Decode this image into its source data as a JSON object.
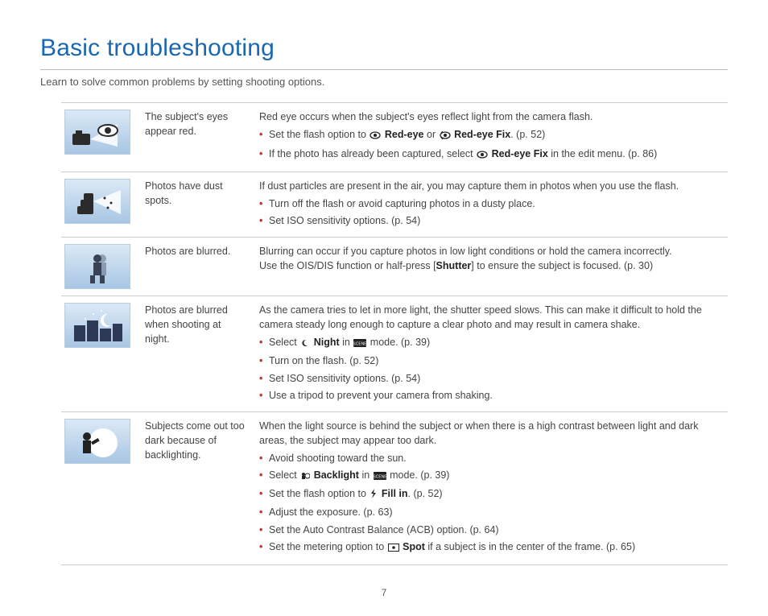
{
  "title": "Basic troubleshooting",
  "intro": "Learn to solve common problems by setting shooting options.",
  "page_number": "7",
  "rows": [
    {
      "problem": "The subject's eyes appear red.",
      "lead": "Red eye occurs when the subject's eyes reflect light from the camera flash.",
      "bullets_a": {
        "b0_pre": "Set the flash option to ",
        "b0_bold1": "Red-eye",
        "b0_mid": " or ",
        "b0_bold2": "Red-eye Fix",
        "b0_post": ". (p. 52)",
        "b1_pre": "If the photo has already been captured, select ",
        "b1_bold": "Red-eye Fix",
        "b1_post": " in the edit menu. (p. 86)"
      }
    },
    {
      "problem": "Photos have dust spots.",
      "lead": "If dust particles are present in the air, you may capture them in photos when you use the flash.",
      "bullets_b": {
        "b0": "Turn off the flash or avoid capturing photos in a dusty place.",
        "b1": "Set ISO sensitivity options. (p. 54)"
      }
    },
    {
      "problem": "Photos are blurred.",
      "lead_pre": "Blurring can occur if you capture photos in low light conditions or hold the camera incorrectly.\nUse the OIS/DIS function or half-press [",
      "lead_bold": "Shutter",
      "lead_post": "] to ensure the subject is focused. (p. 30)"
    },
    {
      "problem": "Photos are blurred when shooting at night.",
      "lead": "As the camera tries to let in more light, the shutter speed slows. This can make it difficult to hold the camera steady long enough to capture a clear photo and may result in camera shake.",
      "bullets_c": {
        "b0_pre": "Select ",
        "b0_bold": "Night",
        "b0_mid": " in ",
        "b0_post": " mode. (p. 39)",
        "b1": "Turn on the flash. (p. 52)",
        "b2": "Set ISO sensitivity options. (p. 54)",
        "b3": "Use a tripod to prevent your camera from shaking."
      }
    },
    {
      "problem": "Subjects come out too dark because of backlighting.",
      "lead": "When the light source is behind the subject or when there is a high contrast between light and dark areas, the subject may appear too dark.",
      "bullets_d": {
        "b0": "Avoid shooting toward the sun.",
        "b1_pre": "Select ",
        "b1_bold": "Backlight",
        "b1_mid": " in ",
        "b1_post": " mode. (p. 39)",
        "b2_pre": "Set the flash option to ",
        "b2_bold": "Fill in",
        "b2_post": ". (p. 52)",
        "b3": "Adjust the exposure. (p. 63)",
        "b4": "Set the Auto Contrast Balance (ACB) option. (p. 64)",
        "b5_pre": "Set the metering option to ",
        "b5_bold": "Spot",
        "b5_post": " if a subject is in the center of the frame. (p. 65)"
      }
    }
  ]
}
